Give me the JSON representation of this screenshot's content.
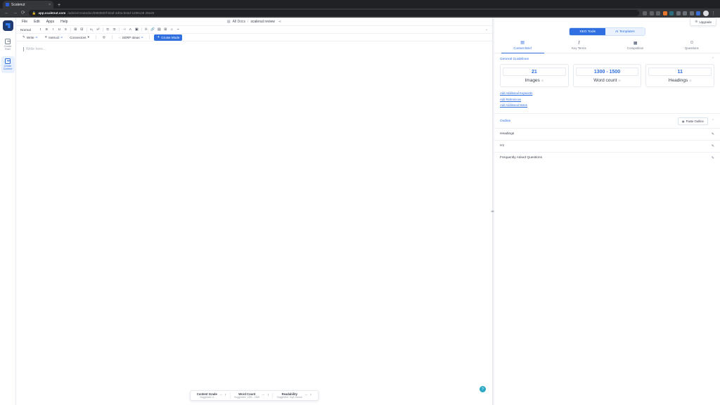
{
  "browser": {
    "tab_title": "Scalenut",
    "tab_close": "×",
    "new_tab": "+",
    "back_icon": "←",
    "forward_icon": "→",
    "reload_icon": "⟳",
    "lock_icon": "🔒",
    "url_host": "app.scalenut.com",
    "url_path": "/admin/createdoc/5993500f-b0af-4d0a-be6d-1206149 25e29",
    "menu_icon": "⋮"
  },
  "rail": {
    "items": [
      {
        "label": "Create Brief",
        "icon": "brief-icon",
        "active": false
      },
      {
        "label": "Create Content",
        "icon": "content-icon",
        "active": true
      }
    ]
  },
  "menubar": {
    "items": [
      "File",
      "Edit",
      "Apps",
      "Help"
    ],
    "doc_icon": "▤",
    "all_docs": "All Docs",
    "separator": "/",
    "doc_name": "scalenut review",
    "share_icon": "⋖"
  },
  "format_toolbar": {
    "style_select": "Normal",
    "chevron": "▾",
    "icons": [
      "font-size-icon",
      "bold-icon",
      "italic-icon",
      "underline-icon",
      "strikethrough-icon",
      "ordered-list-icon",
      "bullet-list-icon",
      "subscript-icon",
      "superscript-icon",
      "indent-decrease-icon",
      "indent-increase-icon",
      "align-left-icon",
      "text-color-icon",
      "highlight-icon",
      "quote-icon",
      "link-icon",
      "image-icon",
      "table-icon",
      "emoji-icon",
      "clear-format-icon"
    ],
    "glyphs": [
      "t",
      "B",
      "I",
      "U",
      "S",
      "⊞",
      "⊟",
      "x₂",
      "x²",
      "⊏",
      "⊐",
      "⊣",
      "A",
      "▣",
      "⊪",
      "🔗",
      "▤",
      "⊞",
      "☺",
      "⌁"
    ],
    "more_icon": "⌄"
  },
  "action_toolbar": {
    "write": {
      "label": "Write",
      "icon": "pen-icon",
      "sup": "AI"
    },
    "instruct": {
      "label": "Instruct",
      "icon": "wand-icon",
      "sup": "AI"
    },
    "connectors": {
      "label": "Connectors",
      "icon": "",
      "chevron": "▾"
    },
    "optimize_icon": "target-icon",
    "serp_ideas": {
      "label": "SERP Ideas",
      "icon": "bulb-icon",
      "sup": "AI"
    },
    "cruise_mode": {
      "label": "Cruise Mode",
      "icon": "rocket-icon"
    }
  },
  "editor": {
    "placeholder": "Write here...",
    "fab_icon": "?"
  },
  "statusbar": {
    "items": [
      {
        "title": "Content Grade",
        "subtitle": "Suggested: A",
        "dash": "–",
        "arrow": "↑"
      },
      {
        "title": "Word Count",
        "subtitle": "Suggested: 1300 - 1500",
        "dash": "–",
        "arrow": "↑"
      },
      {
        "title": "Readability",
        "subtitle": "Suggested: High School",
        "dash": "–",
        "arrow": "↑"
      }
    ]
  },
  "panel": {
    "upgrade": {
      "label": "Upgrade",
      "icon": "crown-icon"
    },
    "segments": [
      {
        "label": "SEO Tools",
        "active": true
      },
      {
        "label": "AI Templates",
        "active": false
      }
    ],
    "tabs": [
      {
        "label": "Content Brief",
        "icon": "document-icon",
        "active": true
      },
      {
        "label": "Key Terms",
        "icon": "key-icon",
        "active": false
      },
      {
        "label": "Competition",
        "icon": "bar-chart-icon",
        "active": false
      },
      {
        "label": "Questions",
        "icon": "question-icon",
        "active": false
      }
    ],
    "general_guidelines": {
      "title": "General Guidelines",
      "collapse_icon": "⌃",
      "cards": [
        {
          "value": "21",
          "label": "Images",
          "dot": "⊙"
        },
        {
          "value": "1300 - 1500",
          "label": "Word count",
          "dot": "⊙"
        },
        {
          "value": "11",
          "label": "Headings",
          "dot": "⊙"
        }
      ],
      "links": [
        "Add Additional Keywords",
        "Add References",
        "Add Additional Notes"
      ]
    },
    "outline": {
      "title": "Outline",
      "paste_button": {
        "label": "Paste Outline",
        "icon": "clipboard-icon"
      },
      "collapse_icon": "⌃",
      "rows": [
        {
          "label": "Headings",
          "edit_icon": "✎"
        },
        {
          "label": "H1",
          "edit_icon": "✎"
        },
        {
          "label": "Frequently Asked Questions",
          "edit_icon": "✎"
        }
      ]
    }
  }
}
